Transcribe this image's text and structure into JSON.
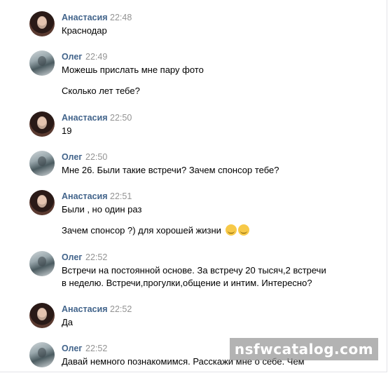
{
  "messages": [
    {
      "author": "Анастасия",
      "time": "22:48",
      "lines": [
        "Краснодар"
      ]
    },
    {
      "author": "Олег",
      "time": "22:49",
      "lines": [
        "Можешь прислать мне пару фото",
        "Сколько лет тебе?"
      ]
    },
    {
      "author": "Анастасия",
      "time": "22:50",
      "lines": [
        "19"
      ]
    },
    {
      "author": "Олег",
      "time": "22:50",
      "lines": [
        "Мне 26. Были такие встречи? Зачем спонсор тебе?"
      ]
    },
    {
      "author": "Анастасия",
      "time": "22:51",
      "lines": [
        "Были , но один раз",
        "Зачем спонсор ?) для хорошей жизни"
      ]
    },
    {
      "author": "Олег",
      "time": "22:52",
      "lines": [
        "Встречи на постоянной основе. За встречу 20 тысяч,2 встречи",
        "в неделю. Встречи,прогулки,общение и интим. Интересно?"
      ]
    },
    {
      "author": "Анастасия",
      "time": "22:52",
      "lines": [
        "Да"
      ]
    },
    {
      "author": "Олег",
      "time": "22:52",
      "lines": [
        "Давай немного познакомимся. Расскажи мне о себе. Чем"
      ]
    }
  ],
  "watermark": "nsfwcatalog.com",
  "colors": {
    "author": "#42648b",
    "time": "#939393",
    "text": "#000000"
  }
}
